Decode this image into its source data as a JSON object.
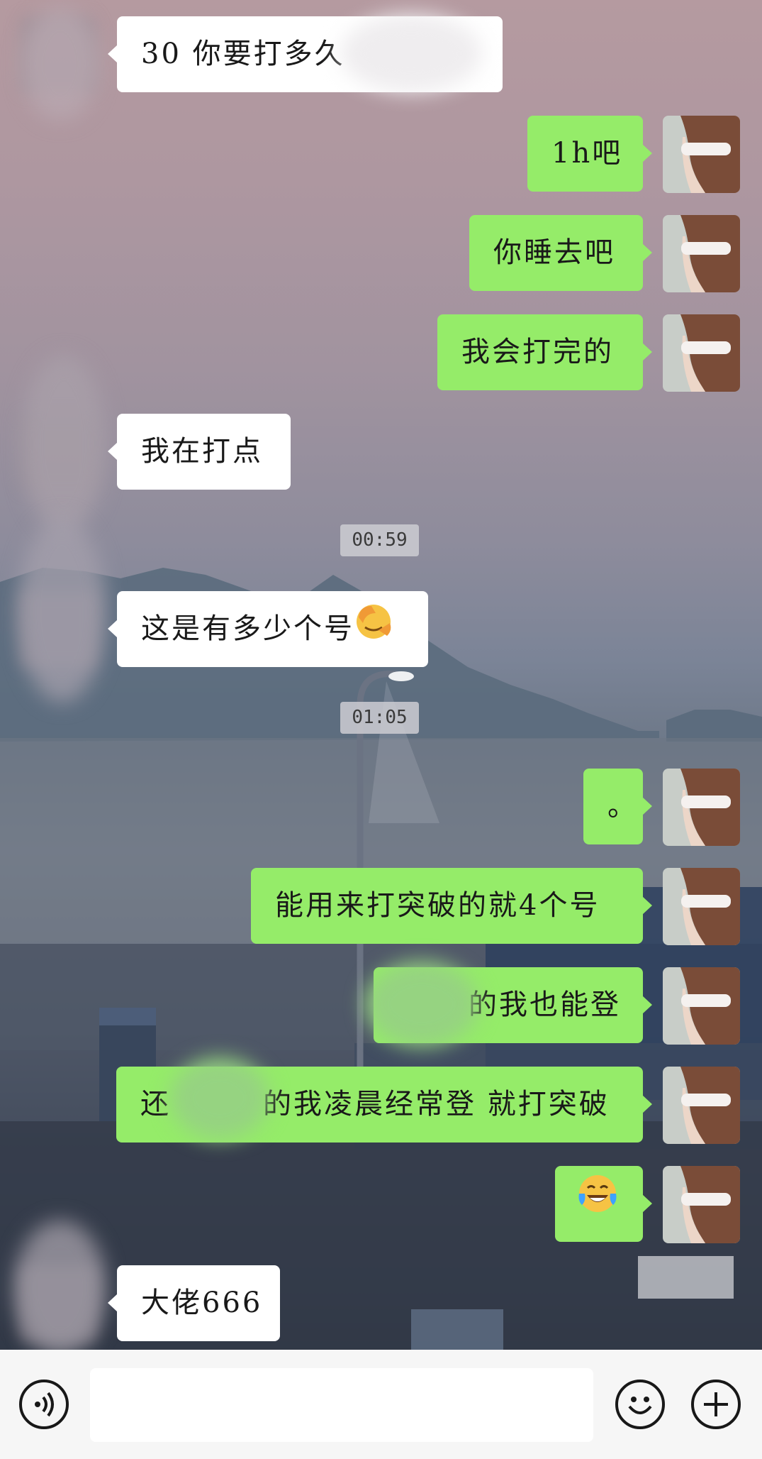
{
  "messages": [
    {
      "text": "30 你要打多久"
    },
    {
      "text": "1h吧"
    },
    {
      "text": "你睡去吧"
    },
    {
      "text": "我会打完的"
    },
    {
      "text": "我在打点"
    },
    {
      "time": "00:59"
    },
    {
      "text": "这是有多少个号"
    },
    {
      "time": "01:05"
    },
    {
      "text": "。"
    },
    {
      "text": "能用来打突破的就4个号"
    },
    {
      "text": "的我也能登"
    },
    {
      "text_before": "还",
      "text_after": "的我凌晨经常登 就打突破"
    },
    {
      "text": ""
    },
    {
      "text": "大佬666"
    }
  ],
  "icons": {
    "voice": "voice-icon",
    "emoji": "emoji-icon",
    "plus": "plus-icon",
    "facepalm": "facepalm-emoji",
    "laughing": "tears-of-joy-emoji"
  },
  "colors": {
    "sent_bubble": "#95ec69",
    "received_bubble": "#ffffff",
    "input_bar": "#f6f6f6"
  }
}
